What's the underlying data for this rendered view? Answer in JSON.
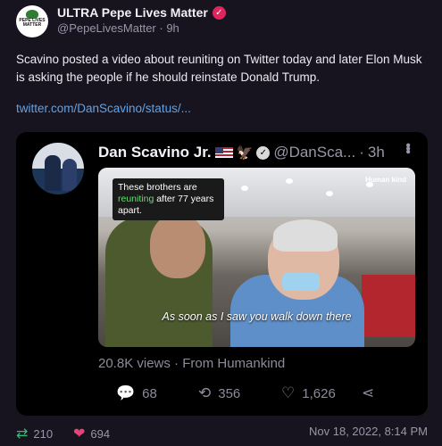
{
  "post": {
    "author_name": "ULTRA Pepe Lives Matter",
    "author_handle": "@PepeLivesMatter",
    "age": "9h",
    "avatar_text": "PEPE LIVES MATTER",
    "text": "Scavino posted a video about reuniting on Twitter today and later Elon Musk is asking the people if he should reinstate Donald Trump.",
    "link": "twitter.com/DanScavino/status/..."
  },
  "quote": {
    "author_name": "Dan Scavino Jr.",
    "author_handle": "@DanSca...",
    "age": "3h",
    "video": {
      "caption_top_prefix": "These brothers are ",
      "caption_top_highlight": "reuniting",
      "caption_top_suffix": " after 77 years apart.",
      "logo": "Human kind",
      "caption_bottom": "As soon as I saw you walk down there"
    },
    "views": "20.8K views",
    "source": "From Humankind",
    "actions": {
      "replies": "68",
      "retweets": "356",
      "likes": "1,626"
    }
  },
  "footer": {
    "retweets": "210",
    "likes": "694",
    "timestamp": "Nov 18, 2022, 8:14 PM"
  },
  "colors": {
    "background": "#17141f",
    "link": "#5fa3e8",
    "retweet": "#2fbf71",
    "like": "#e9417a",
    "verified": "#e0245e"
  },
  "icons": [
    "verified-badge-icon",
    "flag-icon",
    "eagle-icon",
    "more-icon",
    "reply-icon",
    "retweet-icon",
    "like-icon",
    "share-icon"
  ]
}
